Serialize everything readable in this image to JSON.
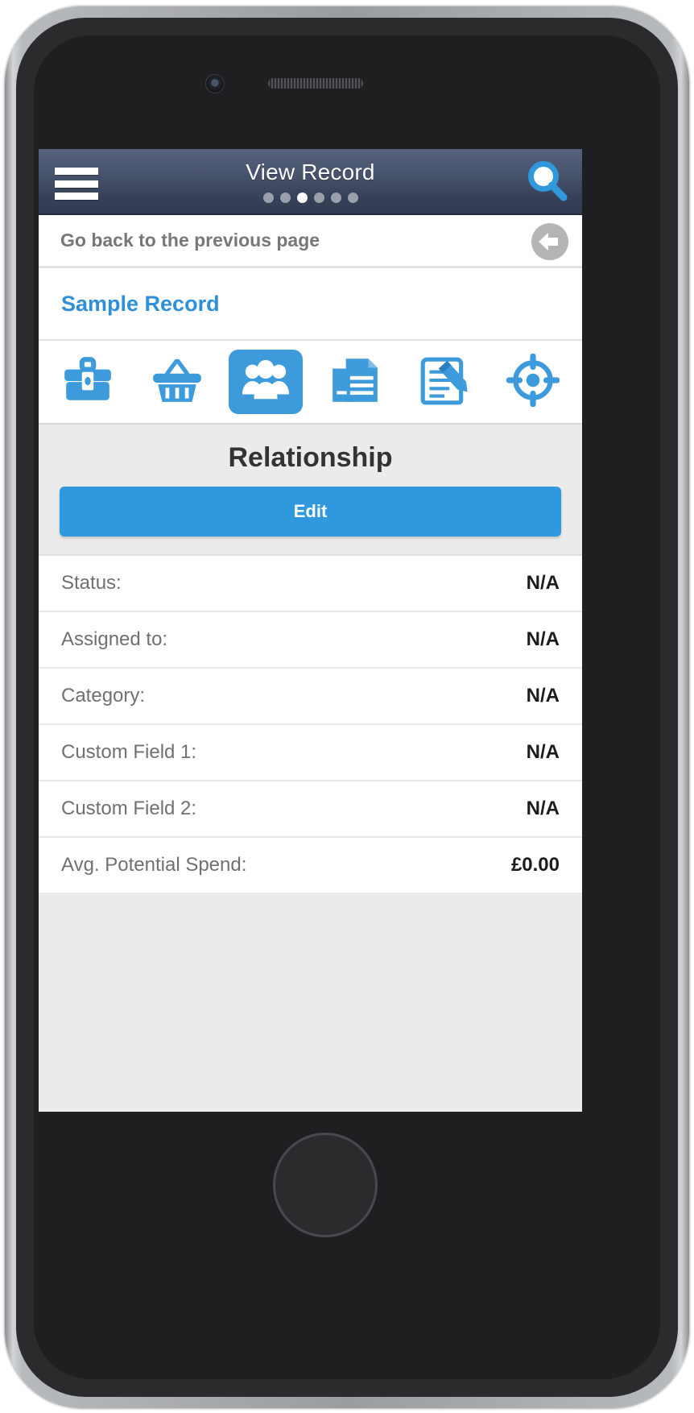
{
  "topbar": {
    "title": "View Record",
    "menu_icon": "hamburger-menu-icon",
    "search_icon": "search-icon",
    "dots_total": 6,
    "dots_active_index": 2
  },
  "backrow": {
    "label": "Go back to the previous page",
    "icon": "back-arrow-circle-icon"
  },
  "record": {
    "link_label": "Sample Record"
  },
  "toolbar": {
    "items": [
      {
        "name": "briefcase-icon",
        "label": "Briefcase",
        "active": false
      },
      {
        "name": "basket-icon",
        "label": "Basket",
        "active": false
      },
      {
        "name": "people-icon",
        "label": "People",
        "active": true
      },
      {
        "name": "documents-icon",
        "label": "Documents",
        "active": false
      },
      {
        "name": "edit-document-icon",
        "label": "Notes",
        "active": false
      },
      {
        "name": "target-icon",
        "label": "Target",
        "active": false
      }
    ]
  },
  "section": {
    "title": "Relationship",
    "edit_label": "Edit"
  },
  "fields": [
    {
      "label": "Status:",
      "value": "N/A"
    },
    {
      "label": "Assigned to:",
      "value": "N/A"
    },
    {
      "label": "Category:",
      "value": "N/A"
    },
    {
      "label": "Custom Field 1:",
      "value": "N/A"
    },
    {
      "label": "Custom Field 2:",
      "value": "N/A"
    },
    {
      "label": "Avg. Potential Spend:",
      "value": "£0.00"
    }
  ],
  "colors": {
    "accent_blue": "#3098dc",
    "header_navy": "#3a4560",
    "panel_gray": "#ebebeb",
    "link_blue": "#2f8fd8"
  }
}
